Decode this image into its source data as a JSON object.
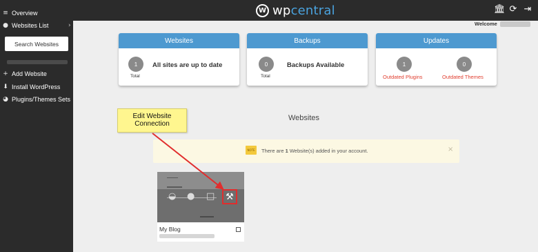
{
  "brand": {
    "logo_mark": "W",
    "logo_wp": "wp",
    "logo_central": "central"
  },
  "sidebar": {
    "items": [
      {
        "label": "Overview",
        "icon": "layers-icon"
      },
      {
        "label": "Websites List",
        "icon": "globe-icon"
      },
      {
        "label": "Add Website",
        "icon": "plus-icon"
      },
      {
        "label": "Install WordPress",
        "icon": "download-icon"
      },
      {
        "label": "Plugins/Themes Sets",
        "icon": "pie-icon"
      }
    ],
    "search_label": "Search Websites"
  },
  "header": {
    "welcome": "Welcome",
    "icons": [
      "bank-icon",
      "refresh-icon",
      "logout-icon"
    ]
  },
  "cards": {
    "websites": {
      "title": "Websites",
      "count": "1",
      "count_label": "Total",
      "text": "All sites are up to date"
    },
    "backups": {
      "title": "Backups",
      "count": "0",
      "count_label": "Total",
      "text": "Backups Available"
    },
    "updates": {
      "title": "Updates",
      "plugins_count": "1",
      "plugins_label": "Outdated Plugins",
      "themes_count": "0",
      "themes_label": "Outdated Themes"
    }
  },
  "section_title": "Websites",
  "notice": {
    "icon_text": "NOTE",
    "prefix": "There are ",
    "count": "1",
    "suffix": " Website(s) added in your account."
  },
  "site": {
    "name": "My Blog"
  },
  "callout": {
    "line1": "Edit Website",
    "line2": "Connection"
  },
  "colors": {
    "accent": "#4d99d0",
    "sidebar": "#2b2b2b",
    "warning_text": "#e03c2d",
    "highlight": "#e12d2d",
    "callout_bg": "#fff68f"
  }
}
